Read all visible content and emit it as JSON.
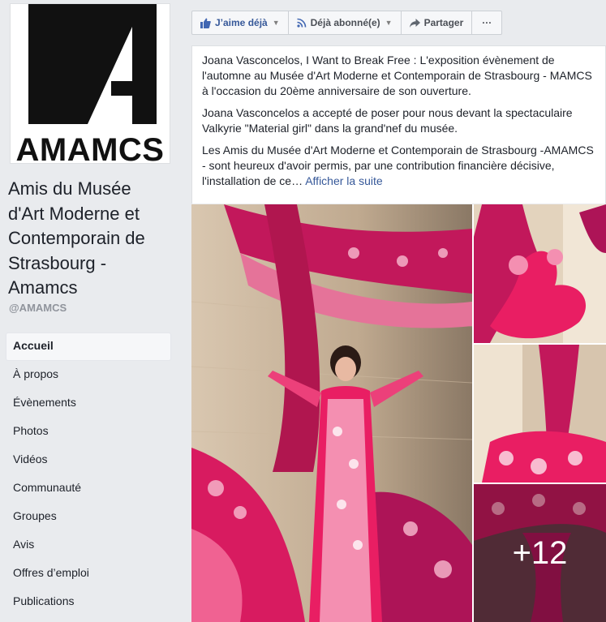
{
  "page": {
    "logo_text": "AMAMCS",
    "name_lines": [
      "Amis du Musée",
      "d'Art Moderne et",
      "Contemporain de",
      "Strasbourg -",
      "Amamcs"
    ],
    "handle": "@AMAMCS"
  },
  "nav": [
    {
      "label": "Accueil",
      "active": true
    },
    {
      "label": "À propos"
    },
    {
      "label": "Évènements"
    },
    {
      "label": "Photos"
    },
    {
      "label": "Vidéos"
    },
    {
      "label": "Communauté"
    },
    {
      "label": "Groupes"
    },
    {
      "label": "Avis"
    },
    {
      "label": "Offres d’emploi"
    },
    {
      "label": "Publications"
    }
  ],
  "actions": {
    "like": "J’aime déjà",
    "follow": "Déjà abonné(e)",
    "share": "Partager",
    "more": "···"
  },
  "post": {
    "p1": "Joana Vasconcelos, I Want to Break Free : L'exposition évènement de l'automne au Musée d'Art Moderne et Contemporain de Strasbourg - MAMCS à l'occasion du 20ème anniversaire de son ouverture.",
    "p2": "Joana Vasconcelos a accepté de poser pour nous devant la spectaculaire Valkyrie \"Material girl\" dans la grand'nef du musée.",
    "p3": "Les Amis du Musée d'Art Moderne et Contemporain de Strasbourg -AMAMCS - sont heureux d'avoir permis, par une contribution financière décisive, l'installation de ce…",
    "see_more": "Afficher la suite"
  },
  "photos": {
    "more_count": "+12"
  },
  "colors": {
    "link": "#365899",
    "page_bg": "#e9ebee",
    "accent_pink": "#c2185b"
  }
}
